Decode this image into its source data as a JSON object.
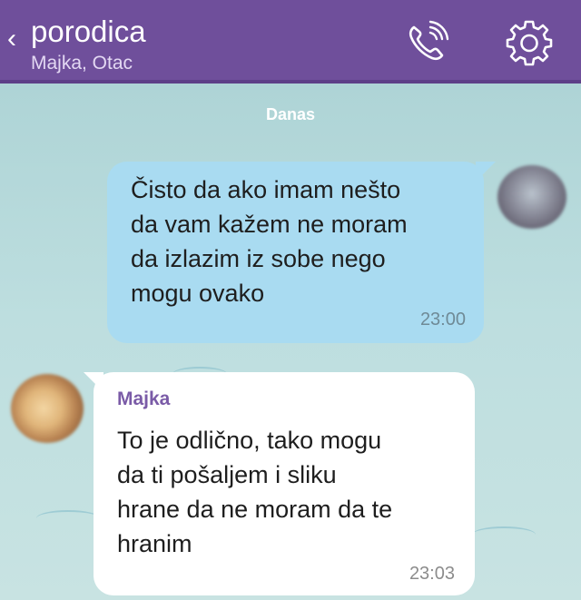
{
  "header": {
    "back_glyph": "‹",
    "title": "porodica",
    "subtitle": "Majka, Otac",
    "icons": [
      "back-icon",
      "phone-call-icon",
      "gear-icon"
    ],
    "colors": {
      "bar": "#6f4f9b",
      "title": "#ffffff"
    }
  },
  "date_divider": "Danas",
  "messages": [
    {
      "direction": "outgoing",
      "text": "Čisto da ako imam nešto\nda vam kažem ne moram\nda izlazim iz sobe nego\nmogu ovako",
      "time": "23:00",
      "bubble_color": "#a9dbf1"
    },
    {
      "direction": "incoming",
      "sender": "Majka",
      "text": "To je odlično, tako mogu\nda ti pošaljem i sliku\nhrane da ne moram da te\nhranim",
      "time": "23:03",
      "bubble_color": "#ffffff"
    }
  ]
}
